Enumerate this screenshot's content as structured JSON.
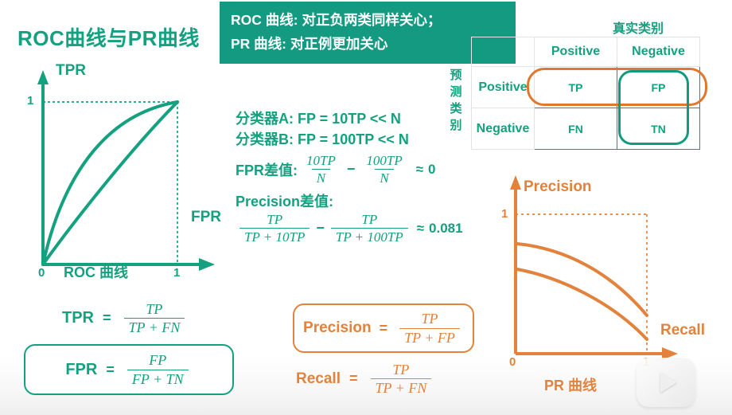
{
  "page": {
    "title": "ROC曲线与PR曲线",
    "accent_green": "#13a17f",
    "accent_orange": "#e2823c",
    "banner_green": "#139a80"
  },
  "banner": {
    "line1": "ROC 曲线: 对正负两类同样关心；",
    "line2": "PR 曲线: 对正例更加关心"
  },
  "roc_chart": {
    "y_axis_label": "TPR",
    "x_axis_label": "FPR",
    "origin_tick": "0",
    "x_tick": "1",
    "y_tick": "1",
    "caption": "ROC 曲线"
  },
  "pr_chart": {
    "y_axis_label": "Precision",
    "x_axis_label": "Recall",
    "origin_tick": "0",
    "x_tick": "1",
    "y_tick": "1",
    "caption": "PR 曲线"
  },
  "classifiers": {
    "line_a": "分类器A: FP = 10TP << N",
    "line_b": "分类器B: FP = 100TP << N",
    "fpr_diff_label": "FPR差值:",
    "fpr_term1_num": "10TP",
    "fpr_term1_den": "N",
    "fpr_minus": "−",
    "fpr_term2_num": "100TP",
    "fpr_term2_den": "N",
    "fpr_approx": "≈",
    "fpr_result": "0",
    "precision_diff_label": "Precision差值:",
    "prec_term1_num": "TP",
    "prec_term1_den": "TP + 10TP",
    "prec_minus": "−",
    "prec_term2_num": "TP",
    "prec_term2_den": "TP + 100TP",
    "prec_approx": "≈",
    "prec_result": "0.081"
  },
  "matrix": {
    "title": "真实类别",
    "row_axis_label": "预测类别",
    "col_headers": [
      "Positive",
      "Negative"
    ],
    "row_headers": [
      "Positive",
      "Negative"
    ],
    "cells": [
      [
        "TP",
        "FP"
      ],
      [
        "FN",
        "TN"
      ]
    ]
  },
  "formulas": {
    "tpr": {
      "label": "TPR",
      "equals": "=",
      "num": "TP",
      "den": "TP + FN"
    },
    "fpr": {
      "label": "FPR",
      "equals": "=",
      "num": "FP",
      "den": "FP + TN"
    },
    "precision": {
      "label": "Precision",
      "equals": "=",
      "num": "TP",
      "den": "TP + FP"
    },
    "recall": {
      "label": "Recall",
      "equals": "=",
      "num": "TP",
      "den": "TP + FN"
    }
  },
  "watermark": {
    "icon": "play-icon"
  },
  "chart_data": [
    {
      "type": "line",
      "title": "ROC 曲线",
      "xlabel": "FPR",
      "ylabel": "TPR",
      "xlim": [
        0,
        1
      ],
      "ylim": [
        0,
        1
      ],
      "grid": false,
      "xticks": [
        "0",
        "1"
      ],
      "yticks": [
        "1"
      ],
      "color": "#13a17f",
      "series": [
        {
          "name": "curve-upper",
          "x": [
            0,
            0.05,
            0.1,
            0.2,
            0.3,
            0.45,
            0.6,
            0.8,
            1.0
          ],
          "y": [
            0,
            0.26,
            0.42,
            0.6,
            0.72,
            0.85,
            0.92,
            0.98,
            1.0
          ]
        },
        {
          "name": "curve-lower",
          "x": [
            0,
            0.05,
            0.12,
            0.25,
            0.4,
            0.55,
            0.7,
            0.85,
            1.0
          ],
          "y": [
            0,
            0.11,
            0.2,
            0.34,
            0.48,
            0.62,
            0.76,
            0.89,
            1.0
          ]
        }
      ],
      "annotations": [
        "dashed guide at x=1",
        "dashed guide at y=1"
      ]
    },
    {
      "type": "line",
      "title": "PR 曲线",
      "xlabel": "Recall",
      "ylabel": "Precision",
      "xlim": [
        0,
        1
      ],
      "ylim": [
        0,
        1
      ],
      "grid": false,
      "xticks": [
        "0",
        "1"
      ],
      "yticks": [
        "1"
      ],
      "color": "#e2823c",
      "series": [
        {
          "name": "curve-upper",
          "x": [
            0,
            0.15,
            0.3,
            0.45,
            0.6,
            0.75,
            0.9,
            1.0
          ],
          "y": [
            0.8,
            0.78,
            0.74,
            0.68,
            0.6,
            0.49,
            0.33,
            0.18
          ]
        },
        {
          "name": "curve-lower",
          "x": [
            0,
            0.15,
            0.3,
            0.45,
            0.6,
            0.75,
            0.9,
            1.0
          ],
          "y": [
            0.62,
            0.59,
            0.54,
            0.47,
            0.39,
            0.29,
            0.16,
            0.04
          ]
        }
      ],
      "annotations": [
        "dashed guide at x=1",
        "dashed guide at y=1"
      ]
    }
  ]
}
